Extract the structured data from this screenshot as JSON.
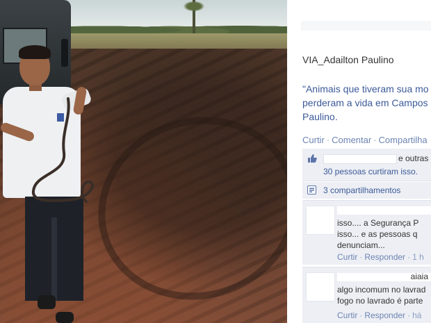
{
  "post": {
    "header": "VIA_Adailton Paulino",
    "text_lines": [
      "\"Animais que tiveram sua mo",
      "perderam a vida em Campos",
      "Paulino."
    ],
    "actions": {
      "like": "Curtir",
      "comment": "Comentar",
      "share": "Compartilha"
    },
    "likes": {
      "others": "e outras",
      "count": "30 pessoas curtiram isso."
    },
    "shares": "3 compartilhamentos"
  },
  "comments": [
    {
      "author": "",
      "lines": [
        "isso.... a Segurança P",
        "isso... e as pessoas q",
        "denunciam..."
      ],
      "actions": {
        "like": "Curtir",
        "reply": "Responder",
        "time": "1 h"
      }
    },
    {
      "author": "aiaia",
      "lines": [
        "algo incomum no lavrad",
        "fogo no lavrado é parte"
      ],
      "actions": {
        "like": "Curtir",
        "reply": "Responder",
        "time": "há"
      }
    }
  ],
  "colors": {
    "link": "#3b5998",
    "action": "#6d84b4",
    "panel": "#edeff4"
  },
  "icons": {
    "like": "thumbs-up-icon",
    "share": "share-icon"
  }
}
